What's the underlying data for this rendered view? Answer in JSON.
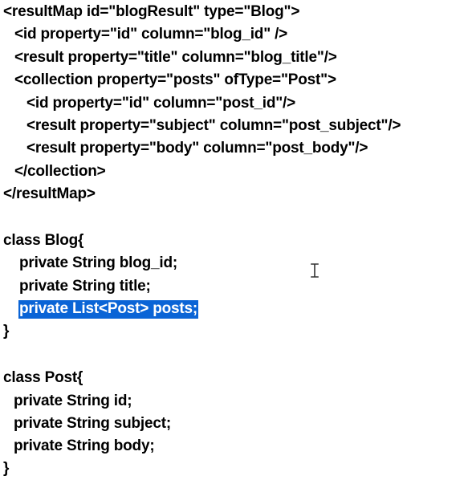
{
  "xml": {
    "line1": "<resultMap id=\"blogResult\" type=\"Blog\">",
    "line2": "<id property=\"id\" column=\"blog_id\" />",
    "line3": "<result property=\"title\" column=\"blog_title\"/>",
    "line4": "<collection property=\"posts\" ofType=\"Post\">",
    "line5": "<id property=\"id\" column=\"post_id\"/>",
    "line6": "<result property=\"subject\" column=\"post_subject\"/>",
    "line7": "<result property=\"body\" column=\"post_body\"/>",
    "line8": "</collection>",
    "line9": "</resultMap>"
  },
  "blog_class": {
    "header": "class Blog{",
    "field1": "private String blog_id;",
    "field2": "private String title;",
    "field3_selected": "private List<Post> posts;",
    "close": "}"
  },
  "post_class": {
    "header": "class Post{",
    "field1": "private String id;",
    "field2": "private String subject;",
    "field3": "private String body;",
    "close": "}"
  },
  "colors": {
    "text": "#000000",
    "selection": "#0a64d6",
    "selection_text": "#ffffff"
  },
  "icons": {
    "cursor": "text-cursor-icon"
  }
}
